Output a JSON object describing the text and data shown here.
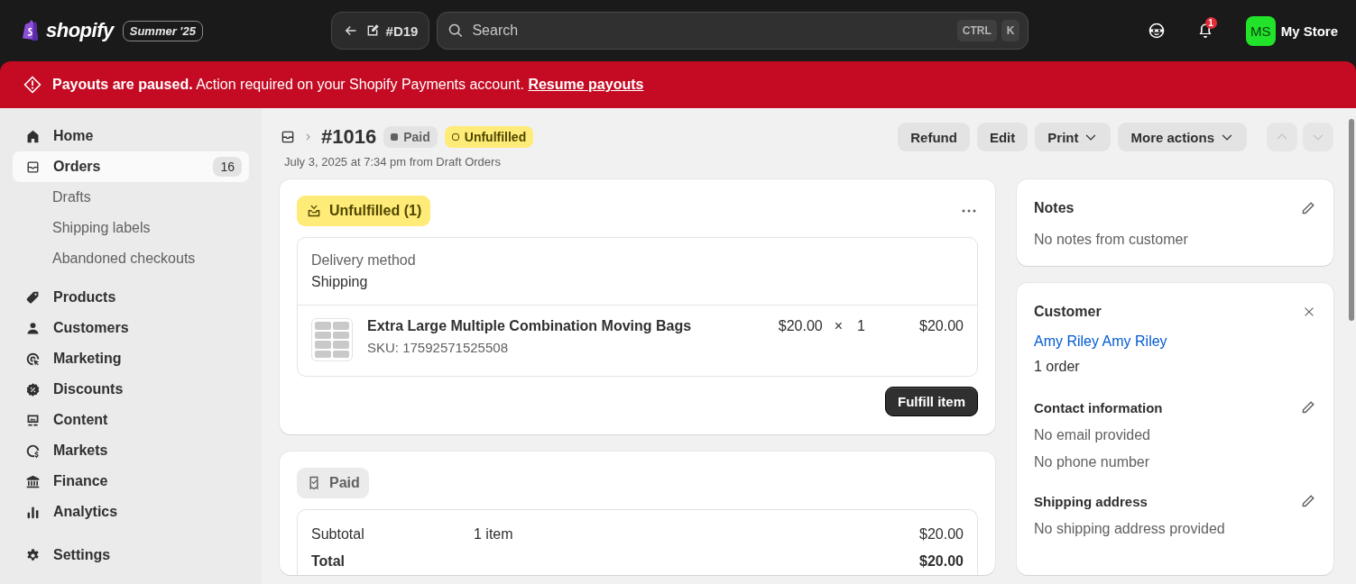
{
  "topbar": {
    "logo": "shopify",
    "edition": "Summer '25",
    "back_label": "#D19",
    "search": {
      "placeholder": "Search",
      "shortcut_keys": [
        "CTRL",
        "K"
      ]
    },
    "notification_count": "1",
    "store": {
      "initials": "MS",
      "name": "My Store"
    }
  },
  "banner": {
    "message": "**Payouts are paused.** Action required on your Shopify Payments account.",
    "link": "Resume payouts"
  },
  "sidebar": {
    "items": [
      {
        "label": "Home",
        "selected": false
      },
      {
        "label": "Orders",
        "selected": true,
        "badge": "16",
        "children": [
          {
            "label": "Drafts"
          },
          {
            "label": "Shipping labels"
          },
          {
            "label": "Abandoned checkouts"
          }
        ]
      },
      {
        "label": "Products",
        "selected": false
      },
      {
        "label": "Customers",
        "selected": false
      },
      {
        "label": "Marketing",
        "selected": false
      },
      {
        "label": "Discounts",
        "selected": false
      },
      {
        "label": "Content",
        "selected": false
      },
      {
        "label": "Markets",
        "selected": false
      },
      {
        "label": "Finance",
        "selected": false
      },
      {
        "label": "Analytics",
        "selected": false
      }
    ],
    "settings": {
      "label": "Settings",
      "selected": false
    }
  },
  "order": {
    "title": "#1016",
    "badges": [
      {
        "label": "Paid",
        "kind": "payment"
      },
      {
        "label": "Unfulfilled",
        "kind": "fulfillment"
      }
    ],
    "subtitle": "July 3, 2025 at 7:34 pm from Draft Orders",
    "actions": [
      {
        "label": "Refund",
        "dropdown": false
      },
      {
        "label": "Edit",
        "dropdown": false
      },
      {
        "label": "Print",
        "dropdown": true
      },
      {
        "label": "More actions",
        "dropdown": true
      }
    ],
    "pager": [
      {
        "disabled": true
      },
      {
        "disabled": true
      }
    ],
    "fulfillment": {
      "status": "Unfulfilled (1)",
      "delivery_label": "Delivery method",
      "delivery_value": "Shipping",
      "line_items": [
        {
          "name": "Extra Large Multiple Combination Moving Bags",
          "sku": "SKU: 17592571525508",
          "price": "$20.00",
          "times": "×",
          "quantity": "1",
          "total": "$20.00"
        }
      ],
      "button": "Fulfill item"
    },
    "payment": {
      "status": "Paid",
      "rows": [
        {
          "kind": "subtotal",
          "label": "Subtotal",
          "detail": "1 item",
          "amount": "$20.00"
        },
        {
          "kind": "total",
          "label": "Total",
          "amount": "$20.00"
        }
      ]
    },
    "notes": {
      "title": "Notes",
      "text": "No notes from customer"
    },
    "customer": {
      "title": "Customer",
      "name": "Amy Riley Amy Riley",
      "orders": "1 order",
      "sections": [
        {
          "title": "Contact information",
          "lines": [
            "No email provided",
            "No phone number"
          ]
        },
        {
          "title": "Shipping address",
          "lines": [
            "No shipping address provided"
          ]
        }
      ]
    }
  }
}
